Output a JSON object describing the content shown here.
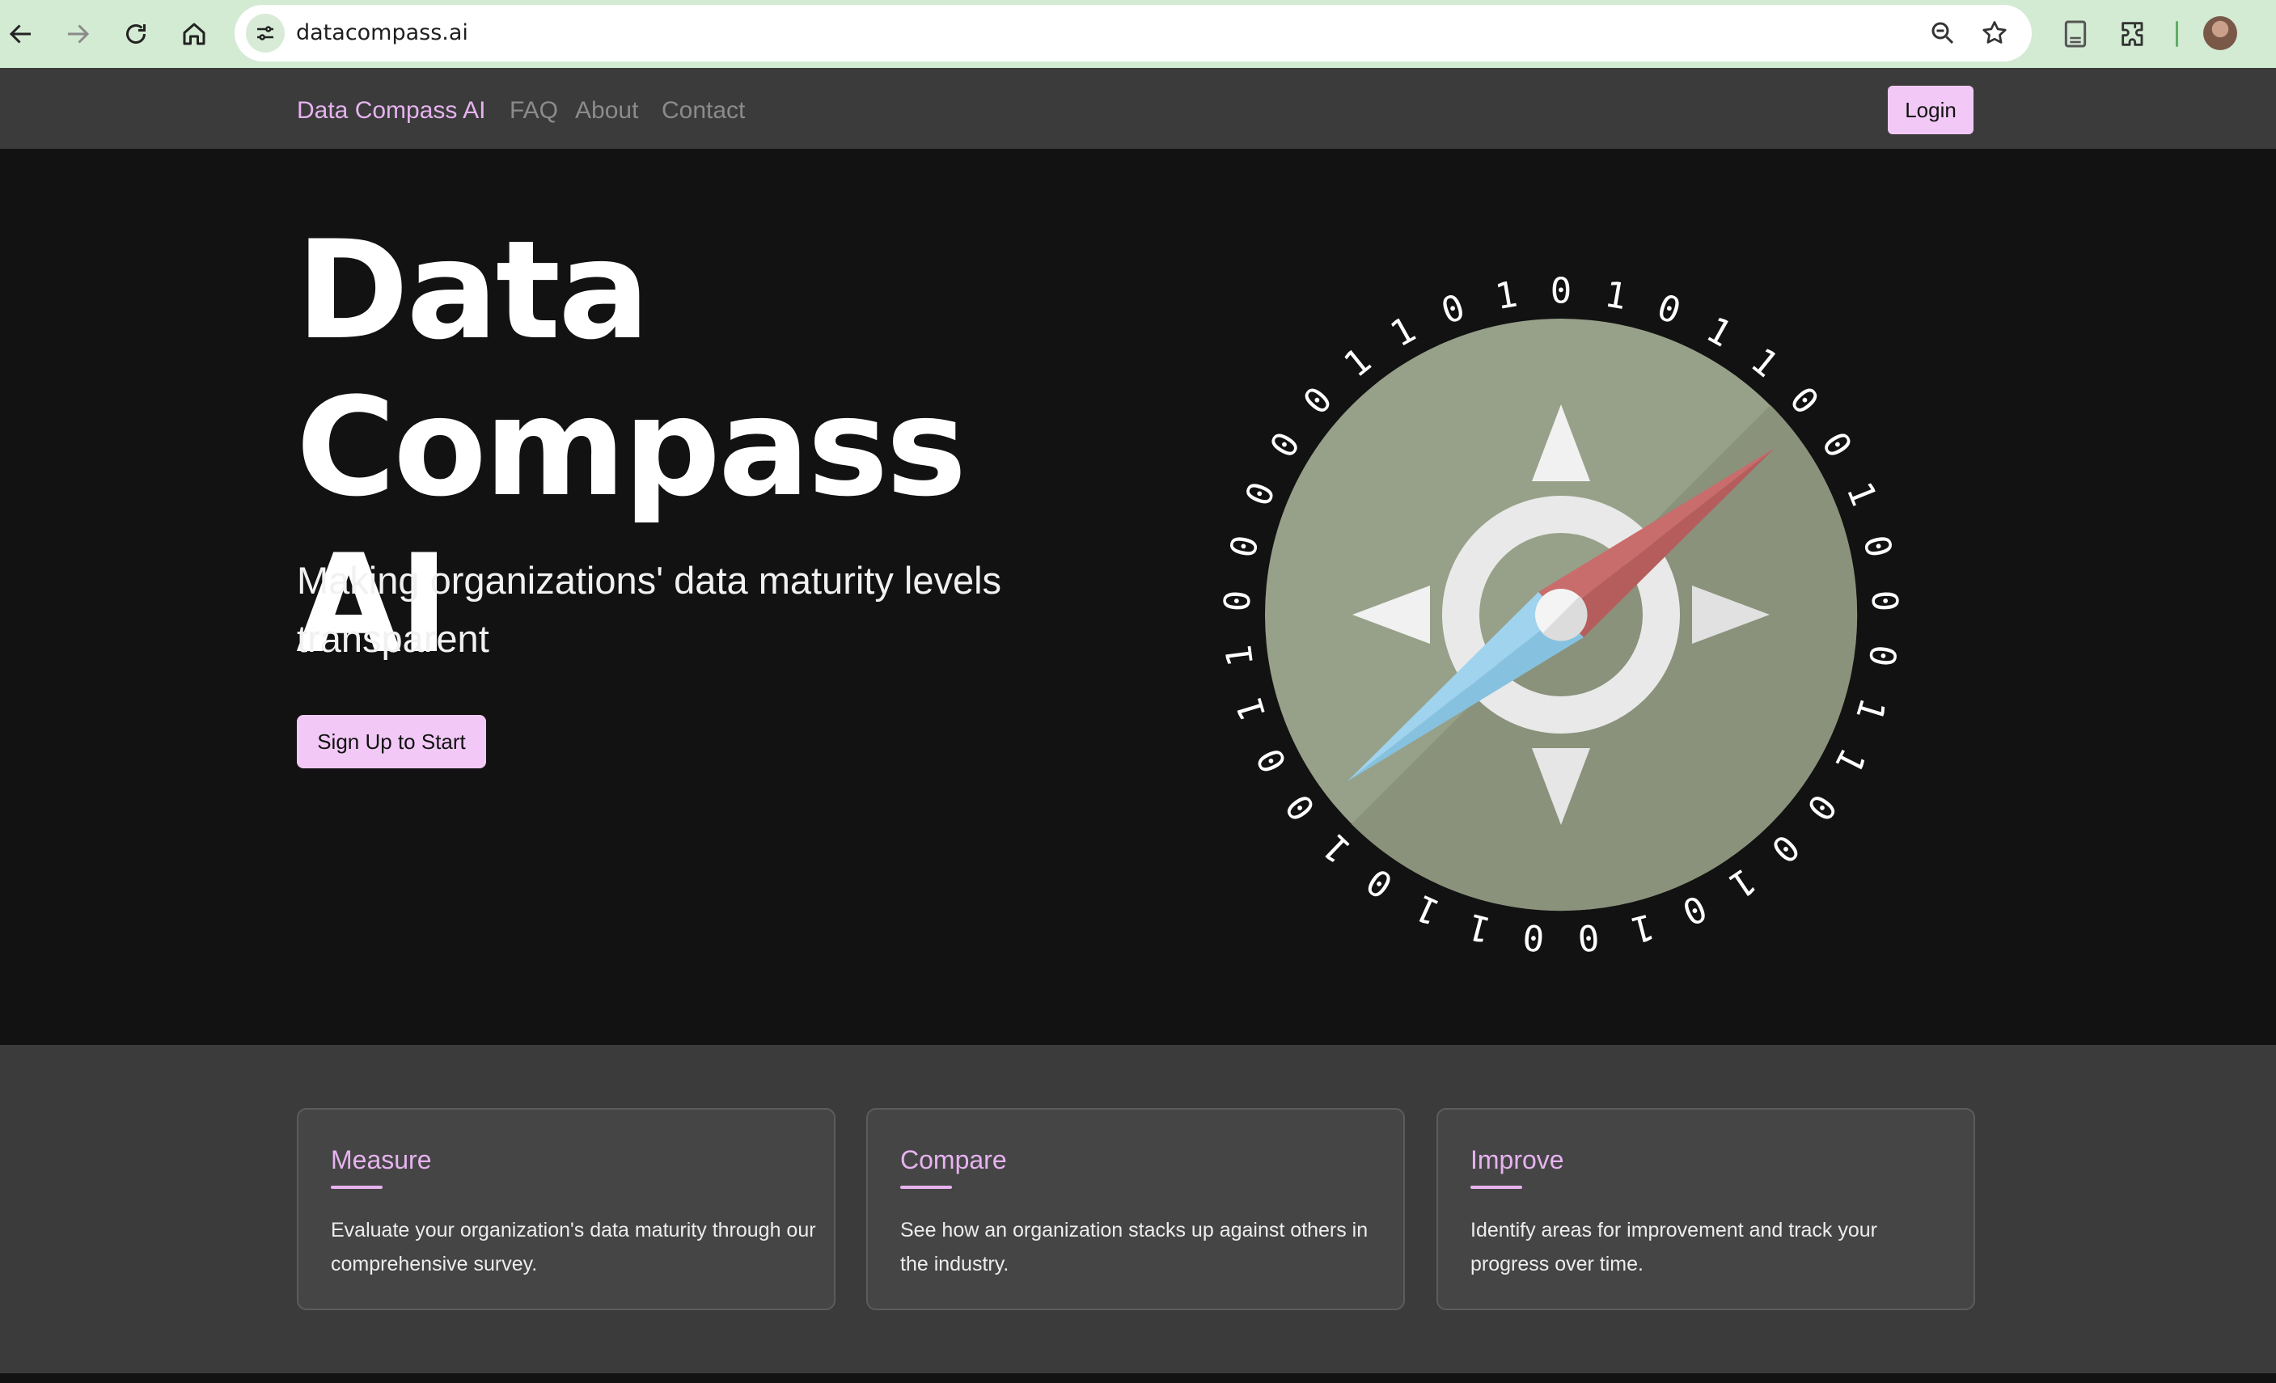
{
  "browser": {
    "url": "datacompass.ai"
  },
  "nav": {
    "brand": "Data Compass AI",
    "links": [
      "FAQ",
      "About",
      "Contact"
    ],
    "login_label": "Login"
  },
  "hero": {
    "title_line1": "Data",
    "title_line2": "Compass AI",
    "subtitle": "Making organizations' data maturity levels transparent",
    "cta_label": "Sign Up to Start",
    "ring_digits": [
      "0",
      "1",
      "0",
      "1",
      "1",
      "0",
      "0",
      "1",
      "0",
      "0",
      "0",
      "1",
      "1",
      "0",
      "0",
      "1",
      "0",
      "1",
      "0",
      "0",
      "1",
      "1",
      "0",
      "1",
      "0",
      "0",
      "1",
      "1",
      "0",
      "0",
      "0",
      "0",
      "0",
      "1",
      "1",
      "0",
      "1"
    ]
  },
  "features": [
    {
      "title": "Measure",
      "text": "Evaluate your organization's data maturity through our comprehensive survey."
    },
    {
      "title": "Compare",
      "text": "See how an organization stacks up against others in the industry."
    },
    {
      "title": "Improve",
      "text": "Identify areas for improvement and track your progress over time."
    }
  ],
  "colors": {
    "accent": "#f2c9f6",
    "accent_text": "#e6b3ef",
    "navbar": "#3b3b3b",
    "hero_bg": "#121212",
    "compass_face": "#97a189",
    "needle_red": "#c56a6a",
    "needle_blue": "#8fcbe8"
  }
}
